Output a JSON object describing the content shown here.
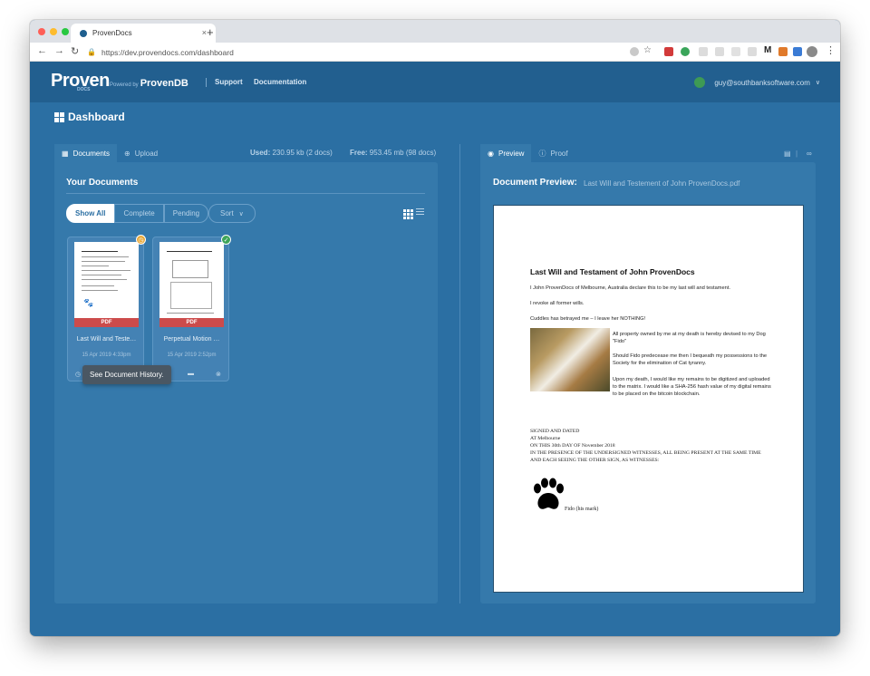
{
  "browser": {
    "tab_title": "ProvenDocs",
    "new_tab": "+",
    "url": "https://dev.provendocs.com/dashboard",
    "close_tab": "×"
  },
  "header": {
    "logo_main": "Proven",
    "logo_sub": "DOCS",
    "powered_by": "Powered by",
    "powered_brand": "ProvenDB",
    "nav": [
      "Support",
      "Documentation"
    ],
    "user_email": "guy@southbanksoftware.com"
  },
  "page": {
    "title": "Dashboard"
  },
  "left_panel": {
    "tabs": [
      "Documents",
      "Upload"
    ],
    "used_label": "Used:",
    "used_value": "230.95 kb (2 docs)",
    "free_label": "Free:",
    "free_value": "953.45 mb (98 docs)",
    "heading": "Your Documents",
    "filters": [
      "Show All",
      "Complete",
      "Pending"
    ],
    "sort_label": "Sort",
    "documents": [
      {
        "name": "Last Will and Teste…",
        "date": "15 Apr 2019 4:33pm",
        "type": "PDF",
        "status_color": "#e8a93a"
      },
      {
        "name": "Perpetual Motion …",
        "date": "15 Apr 2019 2:52pm",
        "type": "PDF",
        "status_color": "#3ea55a"
      }
    ],
    "tooltip": "See Document History."
  },
  "right_panel": {
    "tabs": [
      "Preview",
      "Proof"
    ],
    "heading": "Document Preview:",
    "file_name": "Last Will and Testement of John ProvenDocs.pdf"
  },
  "document": {
    "title": "Last Will and Testament of John ProvenDocs",
    "p1": "I John ProvenDocs of Melbourne, Australia declare this to be my last will and testament.",
    "p2": "I revoke all former wills.",
    "p3": "Cuddles has betrayed me – I leave her NOTHING!",
    "p4": "All property owned by me at my death is hereby devised to my Dog \"Fido\"",
    "p5": "Should Fido predecease me then I bequeath my possessions to the Society for the elimination of Cat tyranny.",
    "p6": "Upon my death, I would like my remains to be digitized and uploaded to the matrix.  I would like a SHA-256 hash value of my digital remains to be placed on the bitcoin blockchain.",
    "s1": "SIGNED AND DATED",
    "s2": "AT Melbourne",
    "s3": "ON THIS  30th DAY OF November 2018",
    "s4": "IN THE PRESENCE OF THE UNDERSIGNED WITNESSES, ALL BEING PRESENT AT THE SAME TIME AND EACH SEEING THE OTHER SIGN, AS WITNESSES:",
    "signature": "Fido  (his mark)"
  }
}
